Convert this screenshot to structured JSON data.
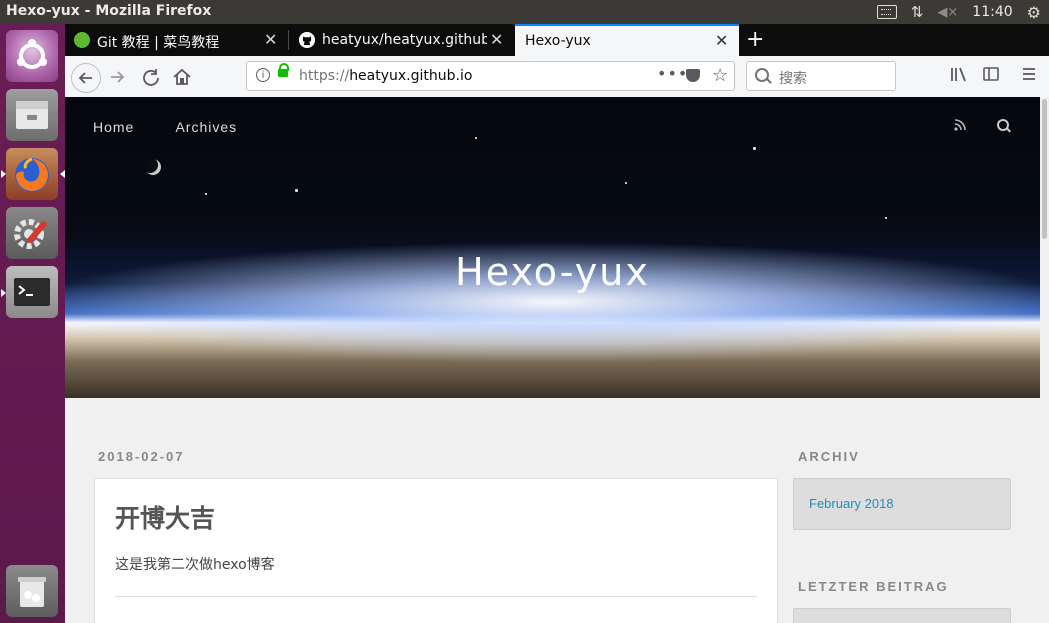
{
  "system": {
    "window_title": "Hexo-yux - Mozilla Firefox",
    "clock": "11:40",
    "tray_icons": [
      "keyboard-icon",
      "network-icon",
      "volume-muted-icon",
      "gear-icon"
    ]
  },
  "launcher": {
    "items": [
      "ubuntu-dash-icon",
      "files-icon",
      "firefox-icon",
      "settings-icon",
      "terminal-icon",
      "trash-icon"
    ]
  },
  "browser": {
    "tabs": [
      {
        "label": "Git 教程 | 菜鸟教程",
        "favicon_color": "#5fb832"
      },
      {
        "label": "heatyux/heatyux.github",
        "favicon_color": "#ffffff"
      },
      {
        "label": "Hexo-yux",
        "active": true
      }
    ],
    "new_tab_label": "+",
    "close_label": "✕",
    "url_scheme": "https://",
    "url_host": "heatyux.github.io",
    "search_placeholder": "搜索",
    "accent": "#0a84ff"
  },
  "site": {
    "nav": {
      "home": "Home",
      "archives": "Archives"
    },
    "title": "Hexo-yux",
    "post": {
      "date": "2018-02-07",
      "title": "开博大吉",
      "excerpt": "这是我第二次做hexo博客"
    },
    "sidebar": {
      "archive_title": "ARCHIV",
      "archive_link": "February 2018",
      "recent_title": "LETZTER BEITRAG"
    },
    "link_color": "#258fb8"
  }
}
